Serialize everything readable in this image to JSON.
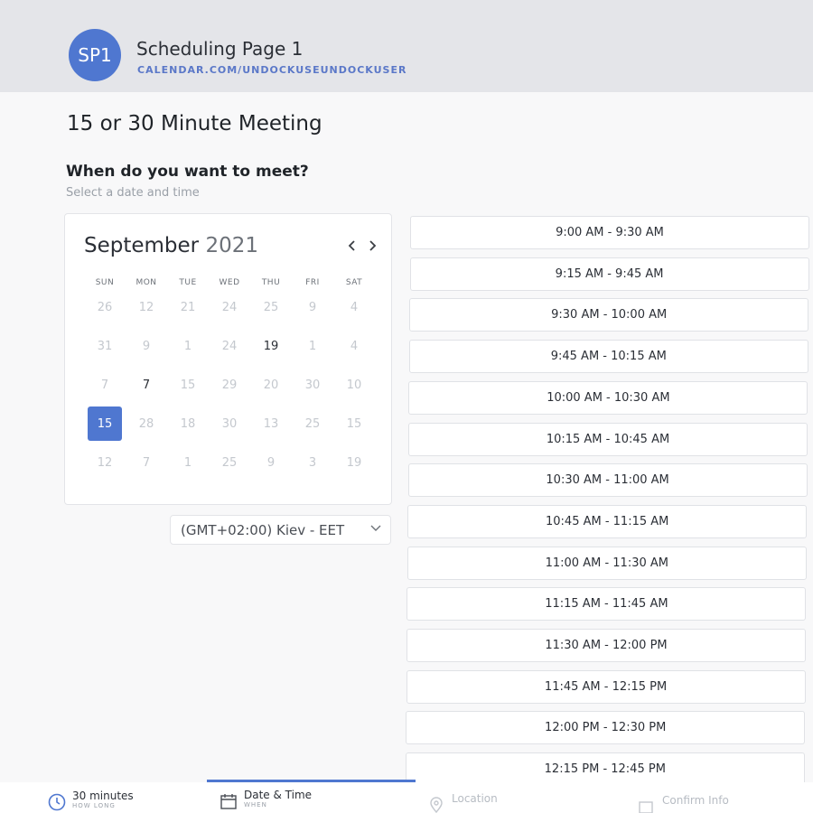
{
  "header": {
    "avatar_initials": "SP1",
    "page_name": "Scheduling Page 1",
    "page_url": "CALENDAR.COM/UNDOCKUSEUNDOCKUSER"
  },
  "meeting": {
    "title": "15 or 30 Minute Meeting",
    "question": "When do you want to meet?",
    "hint": "Select a date and time"
  },
  "calendar": {
    "month": "September",
    "year": "2021",
    "weekdays": [
      "SUN",
      "MON",
      "TUE",
      "WED",
      "THU",
      "FRI",
      "SAT"
    ],
    "weeks": [
      [
        "26",
        "12",
        "21",
        "24",
        "25",
        "9",
        "4"
      ],
      [
        "31",
        "9",
        "1",
        "24",
        "19",
        "1",
        "4"
      ],
      [
        "7",
        "7",
        "15",
        "29",
        "20",
        "30",
        "10"
      ],
      [
        "15",
        "28",
        "18",
        "30",
        "13",
        "25",
        "15"
      ],
      [
        "12",
        "7",
        "1",
        "25",
        "9",
        "3",
        "19"
      ]
    ],
    "active_cells": [
      [
        1,
        4
      ],
      [
        2,
        1
      ]
    ],
    "selected_cell": [
      3,
      0
    ]
  },
  "timezone": {
    "value": "(GMT+02:00) Kiev - EET"
  },
  "slots": [
    "9:00 AM - 9:30 AM",
    "9:15 AM - 9:45 AM",
    "9:30 AM - 10:00 AM",
    "9:45 AM - 10:15 AM",
    "10:00 AM - 10:30 AM",
    "10:15 AM - 10:45 AM",
    "10:30 AM - 11:00 AM",
    "10:45 AM - 11:15 AM",
    "11:00 AM - 11:30 AM",
    "11:15 AM - 11:45 AM",
    "11:30 AM - 12:00 PM",
    "11:45 AM - 12:15 PM",
    "12:00 PM - 12:30 PM",
    "12:15 PM - 12:45 PM"
  ],
  "steps": [
    {
      "label": "30 minutes",
      "sub": "HOW LONG",
      "icon": "clock-icon"
    },
    {
      "label": "Date & Time",
      "sub": "WHEN",
      "icon": "calendar-icon"
    },
    {
      "label": "Location",
      "sub": "",
      "icon": "location-pin-icon"
    },
    {
      "label": "Confirm Info",
      "sub": "",
      "icon": "checkbox-icon"
    }
  ],
  "colors": {
    "accent": "#4f77d0",
    "header_bg": "#e4e5e9",
    "page_bg": "#f8f8f9"
  }
}
